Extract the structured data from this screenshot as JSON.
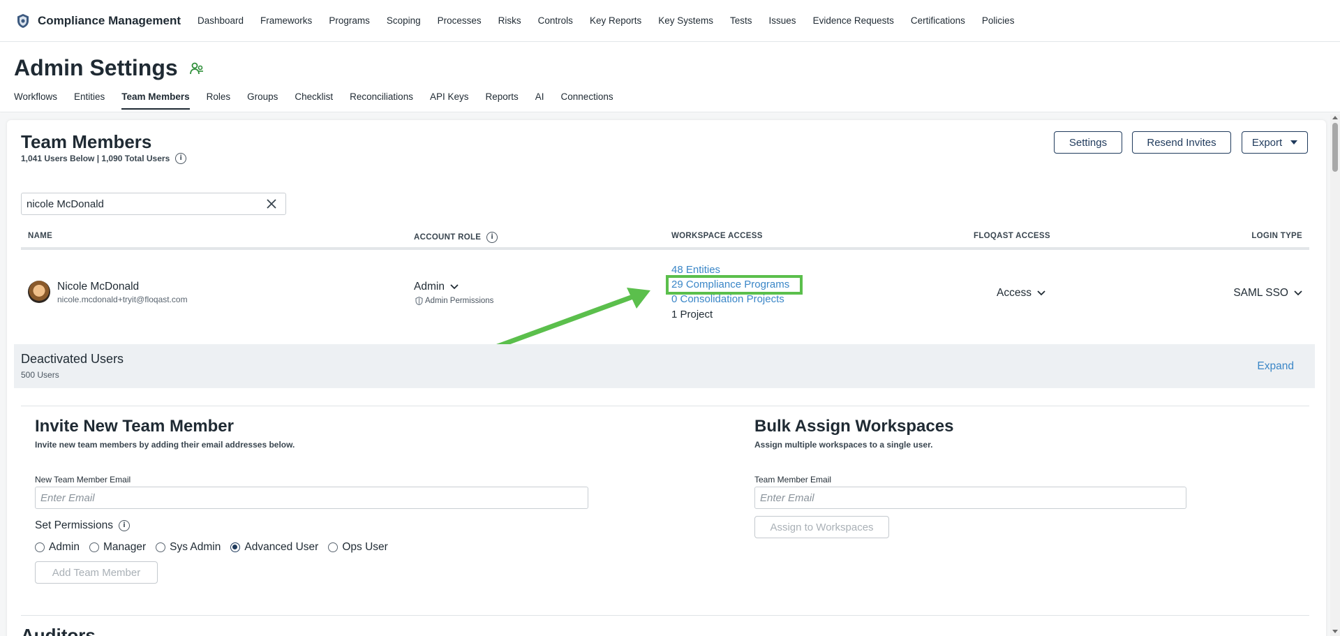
{
  "app": {
    "name": "Compliance Management",
    "nav": [
      "Dashboard",
      "Frameworks",
      "Programs",
      "Scoping",
      "Processes",
      "Risks",
      "Controls",
      "Key Reports",
      "Key Systems",
      "Tests",
      "Issues",
      "Evidence Requests",
      "Certifications",
      "Policies"
    ]
  },
  "admin": {
    "title": "Admin Settings",
    "tabs": [
      "Workflows",
      "Entities",
      "Team Members",
      "Roles",
      "Groups",
      "Checklist",
      "Reconciliations",
      "API Keys",
      "Reports",
      "AI",
      "Connections"
    ],
    "active_tab": "Team Members"
  },
  "team": {
    "title": "Team Members",
    "summary": "1,041 Users Below | 1,090 Total Users",
    "buttons": {
      "settings": "Settings",
      "resend": "Resend Invites",
      "export": "Export"
    },
    "search_value": "nicole McDonald",
    "columns": {
      "name": "NAME",
      "role": "ACCOUNT ROLE",
      "workspace": "WORKSPACE ACCESS",
      "floqast": "FLOQAST ACCESS",
      "login": "LOGIN TYPE"
    },
    "user": {
      "name": "Nicole McDonald",
      "email": "nicole.mcdonald+tryit@floqast.com",
      "role": "Admin",
      "role_perm": "Admin Permissions",
      "workspace": {
        "entities": "48 Entities",
        "programs": "29 Compliance Programs",
        "consolidation": "0 Consolidation Projects",
        "project": "1 Project"
      },
      "floqast_access": "Access",
      "login_type": "SAML SSO"
    }
  },
  "deactivated": {
    "title": "Deactivated Users",
    "count": "500 Users",
    "expand": "Expand"
  },
  "invite": {
    "title": "Invite New Team Member",
    "desc": "Invite new team members by adding their email addresses below.",
    "email_label": "New Team Member Email",
    "email_placeholder": "Enter Email",
    "perm_label": "Set Permissions",
    "options": [
      "Admin",
      "Manager",
      "Sys Admin",
      "Advanced User",
      "Ops User"
    ],
    "selected": "Advanced User",
    "button": "Add Team Member"
  },
  "bulk": {
    "title": "Bulk Assign Workspaces",
    "desc": "Assign multiple workspaces to a single user.",
    "email_label": "Team Member Email",
    "email_placeholder": "Enter Email",
    "button": "Assign to Workspaces"
  },
  "auditors": {
    "title": "Auditors"
  },
  "colors": {
    "link": "#3a86c7",
    "highlight": "#5bbf4c",
    "primary": "#1f3a5c"
  }
}
